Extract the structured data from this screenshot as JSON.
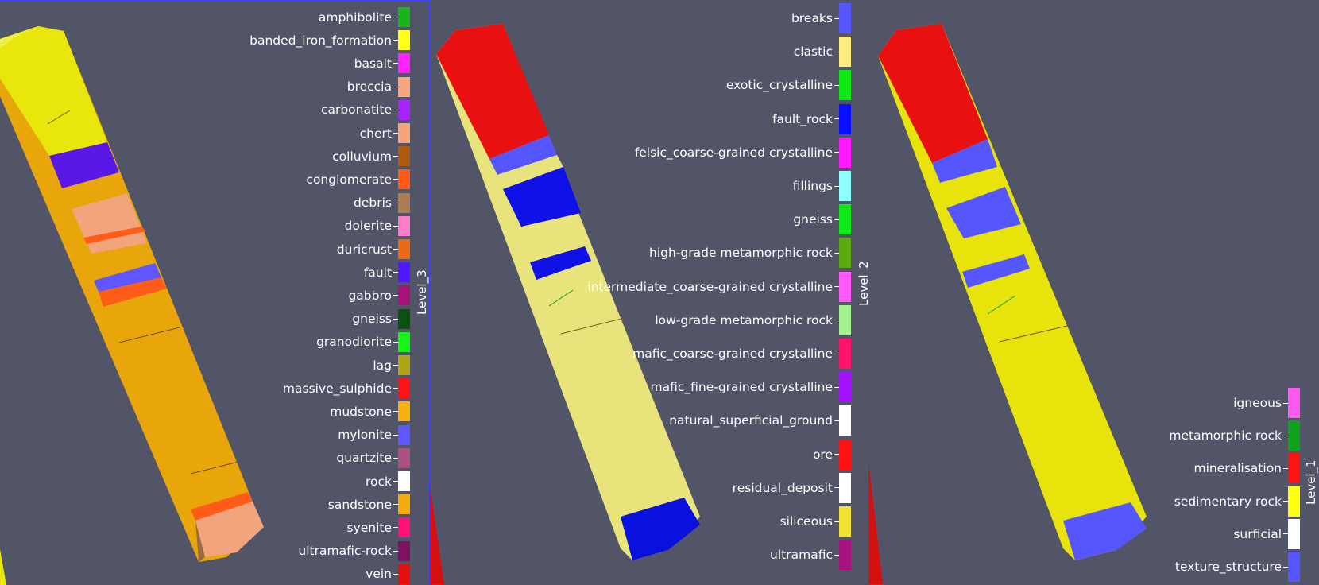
{
  "views": [
    {
      "id": "level3",
      "legend_title": "Level_3",
      "entries": [
        {
          "label": "amphibolite",
          "color": "#19b41c"
        },
        {
          "label": "banded_iron_formation",
          "color": "#ffff17"
        },
        {
          "label": "basalt",
          "color": "#ff22ff"
        },
        {
          "label": "breccia",
          "color": "#f8a47e"
        },
        {
          "label": "carbonatite",
          "color": "#a922ff"
        },
        {
          "label": "chert",
          "color": "#f6a478"
        },
        {
          "label": "colluvium",
          "color": "#b05a10"
        },
        {
          "label": "conglomerate",
          "color": "#ff5b19"
        },
        {
          "label": "debris",
          "color": "#ad7d50"
        },
        {
          "label": "dolerite",
          "color": "#ff7dc8"
        },
        {
          "label": "duricrust",
          "color": "#e96c14"
        },
        {
          "label": "fault",
          "color": "#5118ff"
        },
        {
          "label": "gabbro",
          "color": "#a81277"
        },
        {
          "label": "gneiss",
          "color": "#0a5210"
        },
        {
          "label": "granodiorite",
          "color": "#18f51b"
        },
        {
          "label": "lag",
          "color": "#aea517"
        },
        {
          "label": "massive_sulphide",
          "color": "#ff1218"
        },
        {
          "label": "mudstone",
          "color": "#f6b10c"
        },
        {
          "label": "mylonite",
          "color": "#5e56ff"
        },
        {
          "label": "quartzite",
          "color": "#ac5282"
        },
        {
          "label": "rock",
          "color": "#ffffff"
        },
        {
          "label": "sandstone",
          "color": "#f5aa10"
        },
        {
          "label": "syenite",
          "color": "#ff1278"
        },
        {
          "label": "ultramafic-rock",
          "color": "#801060"
        },
        {
          "label": "vein",
          "color": "#e41010"
        }
      ]
    },
    {
      "id": "level2",
      "legend_title": "Level_2",
      "entries": [
        {
          "label": "breaks",
          "color": "#5656ff"
        },
        {
          "label": "clastic",
          "color": "#ffec7d"
        },
        {
          "label": "exotic_crystalline",
          "color": "#10e816"
        },
        {
          "label": "fault_rock",
          "color": "#0a10ff"
        },
        {
          "label": "felsic_coarse-grained crystalline",
          "color": "#ff18ff"
        },
        {
          "label": "fillings",
          "color": "#8effff"
        },
        {
          "label": "gneiss",
          "color": "#10e81a"
        },
        {
          "label": "high-grade metamorphic rock",
          "color": "#5aaa10"
        },
        {
          "label": "intermediate_coarse-grained crystalline",
          "color": "#ff5af8"
        },
        {
          "label": "low-grade metamorphic rock",
          "color": "#a2f38e"
        },
        {
          "label": "mafic_coarse-grained crystalline",
          "color": "#ff126c"
        },
        {
          "label": "mafic_fine-grained crystalline",
          "color": "#a212ff"
        },
        {
          "label": "natural_superficial_ground",
          "color": "#ffffff"
        },
        {
          "label": "ore",
          "color": "#ff1212"
        },
        {
          "label": "residual_deposit",
          "color": "#ffffff"
        },
        {
          "label": "siliceous",
          "color": "#f3e236"
        },
        {
          "label": "ultramafic",
          "color": "#a81280"
        }
      ]
    },
    {
      "id": "level1",
      "legend_title": "Level_1",
      "entries": [
        {
          "label": "igneous",
          "color": "#ff5af0"
        },
        {
          "label": "metamorphic rock",
          "color": "#10a21a"
        },
        {
          "label": "mineralisation",
          "color": "#ff1212"
        },
        {
          "label": "sedimentary rock",
          "color": "#ffff10"
        },
        {
          "label": "surficial",
          "color": "#ffffff"
        },
        {
          "label": "texture_structure",
          "color": "#5656ff"
        }
      ]
    }
  ]
}
